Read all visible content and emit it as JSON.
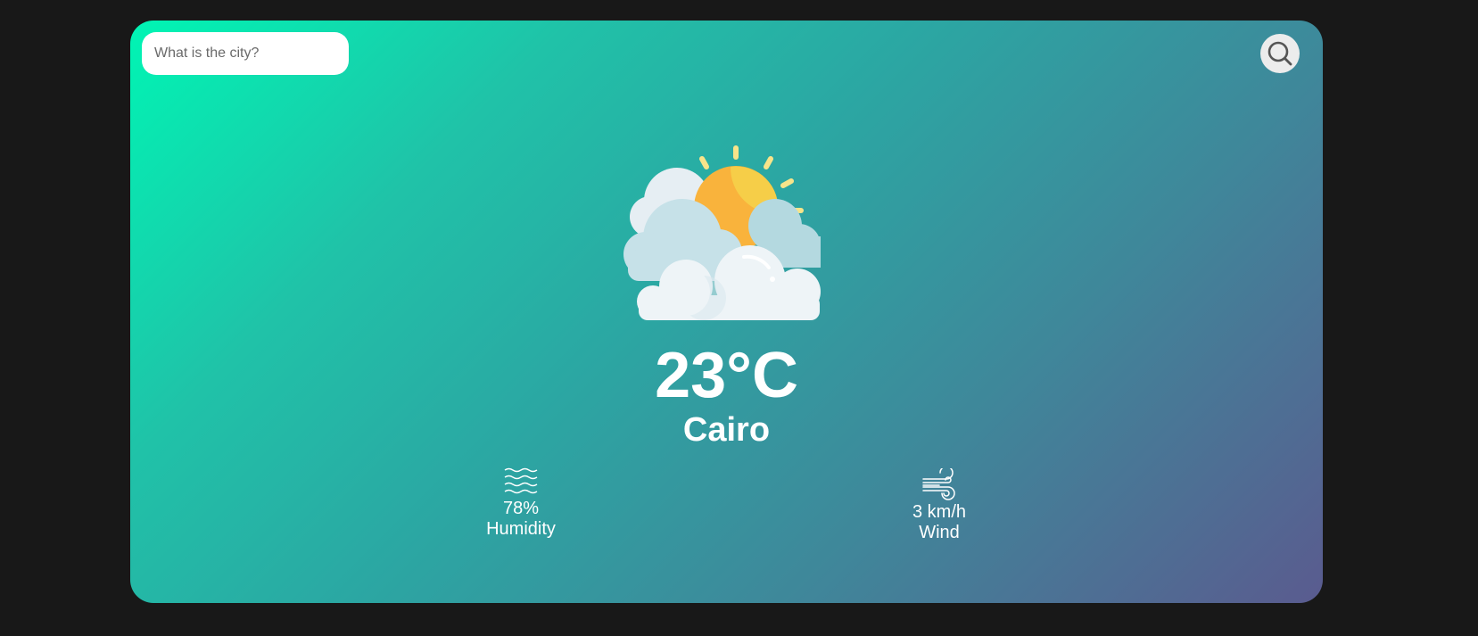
{
  "search": {
    "placeholder": "What is the city?",
    "value": "",
    "button_icon": "search-icon"
  },
  "weather": {
    "icon": "partly-cloudy-sun-icon",
    "temperature": "23°C",
    "city": "Cairo"
  },
  "details": {
    "humidity": {
      "icon": "humidity-icon",
      "value": "78%",
      "label": "Humidity"
    },
    "wind": {
      "icon": "wind-icon",
      "value": "3 km/h",
      "label": "Wind"
    }
  },
  "colors": {
    "background": "#181818",
    "gradient_start": "#00f5b4",
    "gradient_end": "#5a5b8f",
    "text": "#ffffff"
  }
}
